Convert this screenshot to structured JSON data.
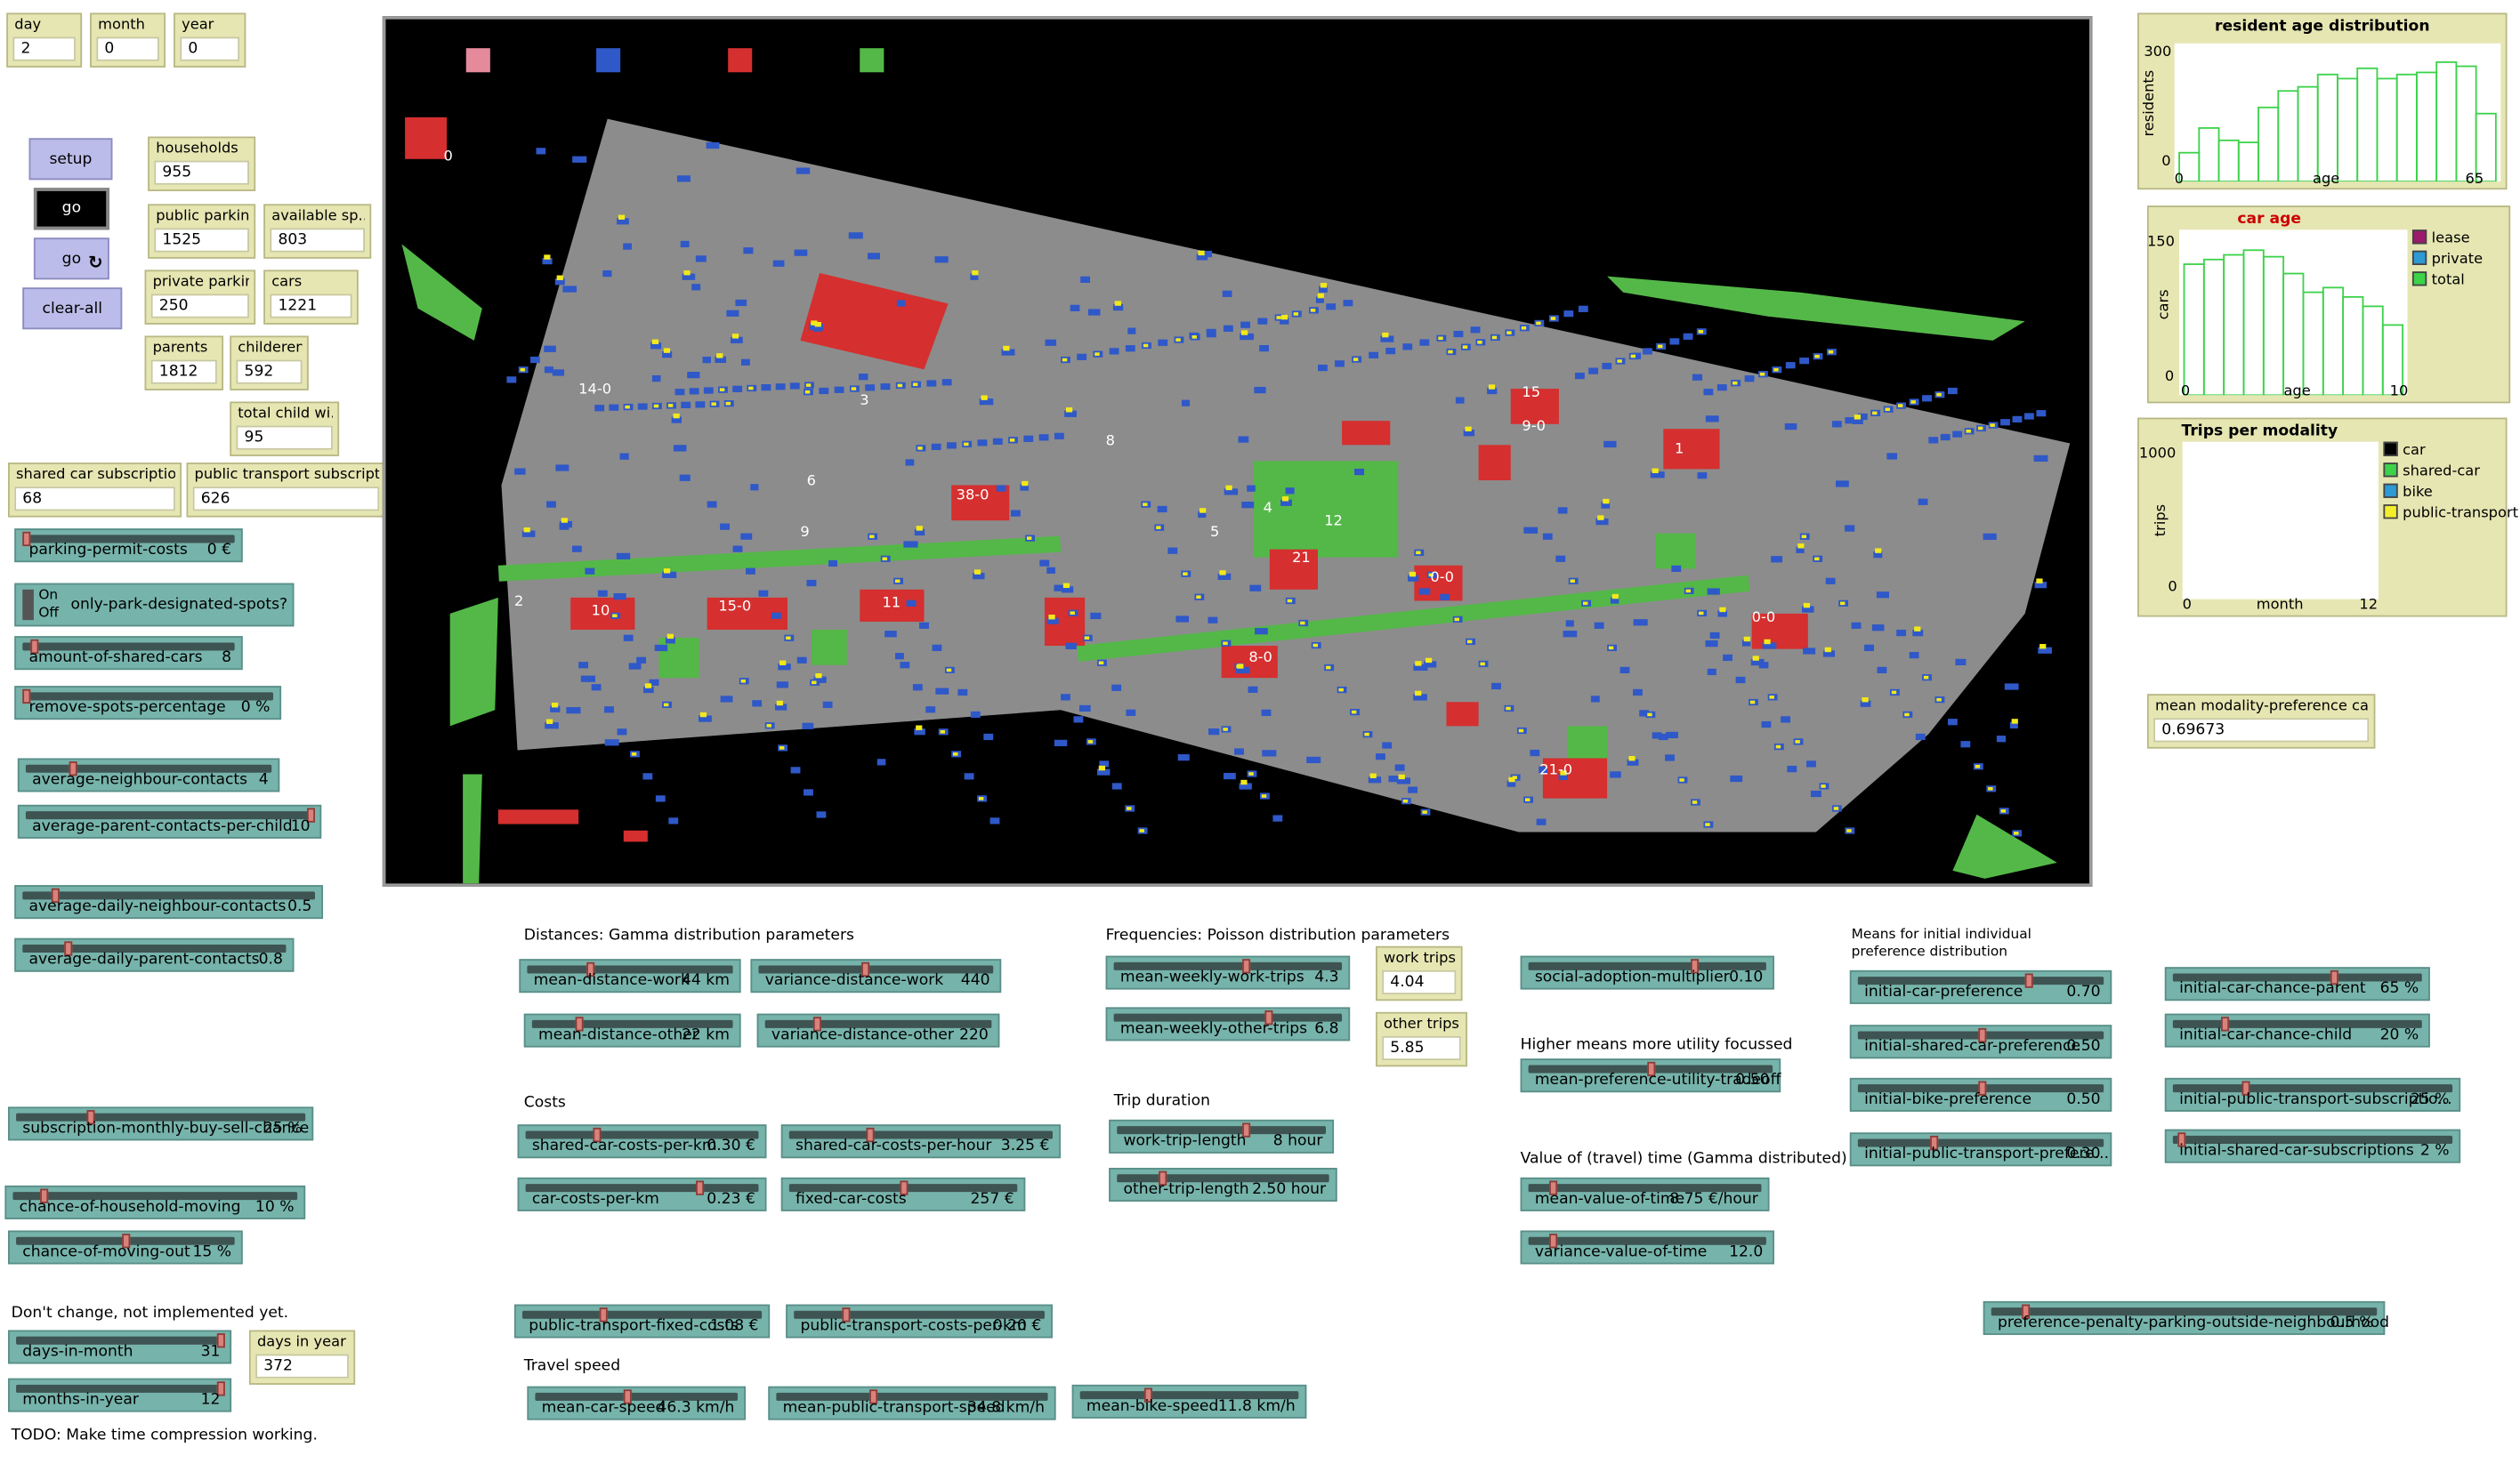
{
  "monitors": {
    "day": {
      "label": "day",
      "value": "2"
    },
    "month": {
      "label": "month",
      "value": "0"
    },
    "year": {
      "label": "year",
      "value": "0"
    },
    "households": {
      "label": "households",
      "value": "955"
    },
    "public_parking": {
      "label": "public parking",
      "value": "1525"
    },
    "available_spots": {
      "label": "available sp...",
      "value": "803"
    },
    "private_parking": {
      "label": "private parking",
      "value": "250"
    },
    "cars": {
      "label": "cars",
      "value": "1221"
    },
    "parents": {
      "label": "parents",
      "value": "1812"
    },
    "childeren": {
      "label": "childeren",
      "value": "592"
    },
    "total_child": {
      "label": "total child wi...",
      "value": "95"
    },
    "shared_car_subs": {
      "label": "shared car subscriptio...",
      "value": "68"
    },
    "pt_subs": {
      "label": "public transport subscripti...",
      "value": "626"
    },
    "work_trips": {
      "label": "work trips",
      "value": "4.04"
    },
    "other_trips": {
      "label": "other trips",
      "value": "5.85"
    },
    "days_in_year": {
      "label": "days in year",
      "value": "372"
    },
    "mean_pref_car": {
      "label": "mean modality-preference car",
      "value": "0.69673"
    }
  },
  "buttons": {
    "setup": "setup",
    "go_once": "go",
    "go_forever": "go",
    "go_forever_icon": "↻",
    "clear_all": "clear-all"
  },
  "switch": {
    "on": "On",
    "off": "Off",
    "label": "only-park-designated-spots?"
  },
  "sliders": [
    {
      "name": "parking-permit-costs",
      "value": "0 €",
      "pos": 0.0
    },
    {
      "name": "amount-of-shared-cars",
      "value": "8",
      "pos": 0.04
    },
    {
      "name": "remove-spots-percentage",
      "value": "0 %",
      "pos": 0.0
    },
    {
      "name": "average-neighbour-contacts",
      "value": "4",
      "pos": 0.18
    },
    {
      "name": "average-parent-contacts-per-child",
      "value": "10",
      "pos": 1.0
    },
    {
      "name": "average-daily-neighbour-contacts",
      "value": "0.5",
      "pos": 0.1
    },
    {
      "name": "average-daily-parent-contacts",
      "value": "0.8",
      "pos": 0.16
    },
    {
      "name": "subscription-monthly-buy-sell-chance",
      "value": "25 %",
      "pos": 0.25
    },
    {
      "name": "chance-of-household-moving",
      "value": "10 %",
      "pos": 0.1
    },
    {
      "name": "chance-of-moving-out",
      "value": "15 %",
      "pos": 0.5
    },
    {
      "name": "days-in-month",
      "value": "31",
      "pos": 1.0
    },
    {
      "name": "months-in-year",
      "value": "12",
      "pos": 1.0
    },
    {
      "name": "mean-distance-work",
      "value": "44 km",
      "pos": 0.3
    },
    {
      "name": "variance-distance-work",
      "value": "440",
      "pos": 0.45
    },
    {
      "name": "mean-distance-other",
      "value": "22 km",
      "pos": 0.22
    },
    {
      "name": "variance-distance-other",
      "value": "220",
      "pos": 0.22
    },
    {
      "name": "mean-weekly-work-trips",
      "value": "4.3",
      "pos": 0.58
    },
    {
      "name": "mean-weekly-other-trips",
      "value": "6.8",
      "pos": 0.68
    },
    {
      "name": "shared-car-costs-per-km",
      "value": "0.30 €",
      "pos": 0.3
    },
    {
      "name": "shared-car-costs-per-hour",
      "value": "3.25 €",
      "pos": 0.3
    },
    {
      "name": "car-costs-per-km",
      "value": "0.23 €",
      "pos": 0.75
    },
    {
      "name": "fixed-car-costs",
      "value": "257 €",
      "pos": 0.5
    },
    {
      "name": "work-trip-length",
      "value": "8 hour",
      "pos": 0.62
    },
    {
      "name": "other-trip-length",
      "value": "2.50 hour",
      "pos": 0.2
    },
    {
      "name": "public-transport-fixed-costs",
      "value": "1.08 €",
      "pos": 0.33
    },
    {
      "name": "public-transport-costs-per-km",
      "value": "0.20 €",
      "pos": 0.2
    },
    {
      "name": "mean-car-speed",
      "value": "46.3 km/h",
      "pos": 0.45
    },
    {
      "name": "mean-public-transport-speed",
      "value": "34.8 km/h",
      "pos": 0.35
    },
    {
      "name": "mean-bike-speed",
      "value": "11.8 km/h",
      "pos": 0.3
    },
    {
      "name": "social-adoption-multiplier",
      "value": "0.10",
      "pos": 0.7
    },
    {
      "name": "mean-preference-utility-tradeoff",
      "value": "0.50",
      "pos": 0.5
    },
    {
      "name": "mean-value-of-time",
      "value": "8.75 €/hour",
      "pos": 0.09
    },
    {
      "name": "variance-value-of-time",
      "value": "12.0",
      "pos": 0.09
    },
    {
      "name": "initial-car-preference",
      "value": "0.70",
      "pos": 0.7
    },
    {
      "name": "initial-shared-car-preference",
      "value": "0.50",
      "pos": 0.5
    },
    {
      "name": "initial-bike-preference",
      "value": "0.50",
      "pos": 0.5
    },
    {
      "name": "initial-public-transport-prefere...",
      "value": "0.30",
      "pos": 0.3
    },
    {
      "name": "initial-car-chance-parent",
      "value": "65 %",
      "pos": 0.65
    },
    {
      "name": "initial-car-chance-child",
      "value": "20 %",
      "pos": 0.2
    },
    {
      "name": "initial-public-transport-subscriptio...",
      "value": "25 %",
      "pos": 0.25
    },
    {
      "name": "initial-shared-car-subscriptions",
      "value": "2 %",
      "pos": 0.02
    },
    {
      "name": "preference-penalty-parking-outside-neighbourhood",
      "value": "0.5 %",
      "pos": 0.08
    }
  ],
  "notes": {
    "distances": "Distances: Gamma distribution parameters",
    "frequencies": "Frequencies: Poisson distribution parameters",
    "costs": "Costs",
    "trip_duration": "Trip duration",
    "travel_speed": "Travel speed",
    "utility": "Higher means more utility focussed",
    "value_time": "Value of (travel) time (Gamma distributed)",
    "means_initial_1": "Means for initial individual",
    "means_initial_2": "preference distribution",
    "dont_change": "Don't change, not implemented yet.",
    "todo": "TODO: Make time compression working."
  },
  "plots": {
    "age": {
      "title": "resident age distribution",
      "ylabel": "residents",
      "xlabel": "age",
      "ymin": "0",
      "ymax": "300",
      "xmin": "0",
      "xmax": "65",
      "values": [
        70,
        130,
        100,
        95,
        180,
        220,
        230,
        260,
        250,
        275,
        250,
        260,
        265,
        290,
        280,
        165
      ]
    },
    "car": {
      "title": "car age",
      "title_color": "#cc0000",
      "ylabel": "cars",
      "xlabel": "age",
      "ymin": "0",
      "ymax": "150",
      "xmin": "0",
      "xmax": "10",
      "values": [
        140,
        145,
        150,
        155,
        148,
        130,
        110,
        115,
        105,
        95,
        75
      ],
      "legend": [
        {
          "label": "lease",
          "color": "#9b1a6a"
        },
        {
          "label": "private",
          "color": "#2d9ad4"
        },
        {
          "label": "total",
          "color": "#3cd24a"
        }
      ]
    },
    "trips": {
      "title": "Trips per modality",
      "ylabel": "trips",
      "xlabel": "month",
      "ymin": "0",
      "ymax": "1000",
      "xmin": "0",
      "xmax": "12",
      "legend": [
        {
          "label": "car",
          "color": "#000000"
        },
        {
          "label": "shared-car",
          "color": "#3cd24a"
        },
        {
          "label": "bike",
          "color": "#2d9ad4"
        },
        {
          "label": "public-transport",
          "color": "#f3ee2a"
        }
      ]
    }
  },
  "world": {
    "labels": [
      "0",
      "14-0",
      "38-0",
      "15-0",
      "10",
      "11",
      "9",
      "4",
      "12",
      "21",
      "0-0",
      "9-0",
      "15",
      "1",
      "8-0",
      "21-0",
      "0-0",
      "2",
      "3",
      "6",
      "8",
      "5"
    ],
    "colors": {
      "road": "#8c8c8c",
      "house": "#2f58c8",
      "park": "#54b848",
      "parking": "#d52f2f",
      "car": "#f2e81a"
    }
  }
}
